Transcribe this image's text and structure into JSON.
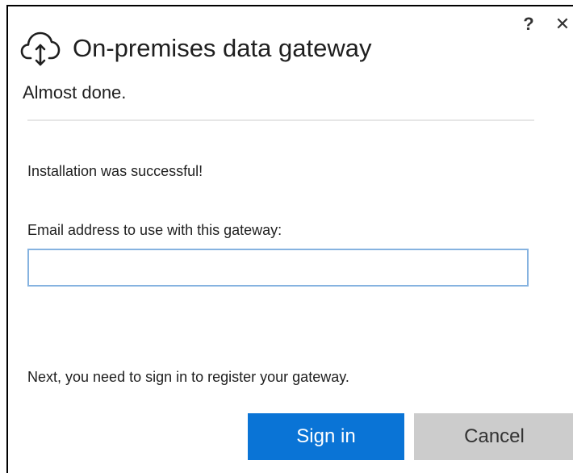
{
  "window": {
    "help_label": "?",
    "close_label": "✕"
  },
  "header": {
    "title": "On-premises data gateway",
    "icon": "cloud-upload-download-icon"
  },
  "subtitle": "Almost done.",
  "messages": {
    "success": "Installation was successful!",
    "next": "Next, you need to sign in to register your gateway."
  },
  "form": {
    "email_label": "Email address to use with this gateway:",
    "email_value": "",
    "email_placeholder": ""
  },
  "buttons": {
    "signin_label": "Sign in",
    "cancel_label": "Cancel"
  },
  "colors": {
    "primary": "#0a74d6",
    "secondary": "#cccccc",
    "input_border": "#86b3e0"
  }
}
